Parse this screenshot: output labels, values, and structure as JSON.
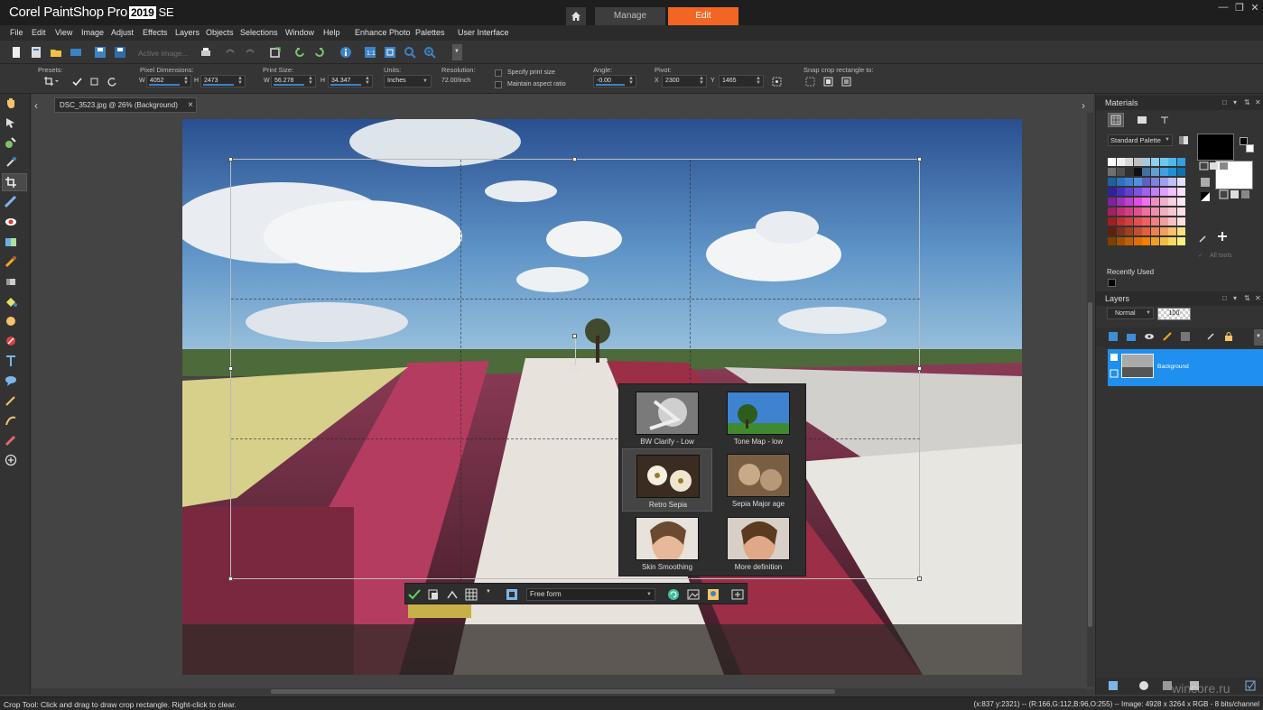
{
  "titlebar": {
    "app_name": "Corel PaintShop Pro",
    "app_year": "2019",
    "app_edition": "SE",
    "tab_manage": "Manage",
    "tab_edit": "Edit"
  },
  "menu": [
    "File",
    "Edit",
    "View",
    "Image",
    "Adjust",
    "Effects",
    "Layers",
    "Objects",
    "Selections",
    "Window",
    "Help",
    "Enhance Photo",
    "Palettes",
    "User Interface"
  ],
  "toolbar": {
    "active_image_placeholder": "Active image..."
  },
  "options": {
    "presets_label": "Presets:",
    "pixel_dim_label": "Pixel Dimensions:",
    "w_label": "W",
    "h_label": "H",
    "pixel_w": "4052",
    "pixel_h": "2473",
    "print_size_label": "Print Size:",
    "print_w": "56.278",
    "print_h": "34.347",
    "units_label": "Units:",
    "units_value": "Inches",
    "resolution_label": "Resolution:",
    "resolution_value": "72.00/inch",
    "specify_print_size": "Specify print size",
    "maintain_aspect": "Maintain aspect ratio",
    "angle_label": "Angle:",
    "angle_value": "-0.00",
    "pivot_label": "Pivot:",
    "x_label": "X",
    "y_label": "Y",
    "pivot_x": "2300",
    "pivot_y": "1465",
    "snap_label": "Snap crop rectangle to:"
  },
  "document": {
    "tab_title": "DSC_3523.jpg @  26% (Background)"
  },
  "cropbar": {
    "mode": "Free form"
  },
  "presets": [
    {
      "label": "BW Clarify - Low"
    },
    {
      "label": "Tone Map - low"
    },
    {
      "label": "Retro Sepia"
    },
    {
      "label": "Sepia Major age"
    },
    {
      "label": "Skin Smoothing"
    },
    {
      "label": "More definition"
    }
  ],
  "materials": {
    "title": "Materials",
    "palette": "Standard Palette",
    "recently_used": "Recently Used",
    "all_tools": "All tools"
  },
  "layers": {
    "title": "Layers",
    "blend_mode": "Normal",
    "opacity": "100",
    "layer_name": "Background"
  },
  "status": {
    "left": "Crop Tool: Click and drag to draw crop rectangle. Right-click to clear.",
    "right": "(x:837 y:2321) -- (R:166,G:112,B:96,O:255) -- Image:  4928 x 3264 x RGB - 8 bits/channel"
  },
  "watermark": "wincore.ru",
  "colors": {
    "accent": "#f26522",
    "selection": "#1f8ff0",
    "bg": "#3c3c3c"
  }
}
